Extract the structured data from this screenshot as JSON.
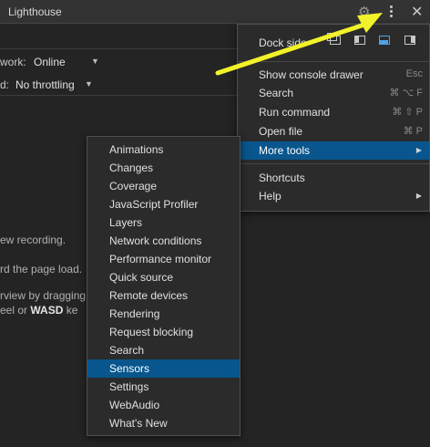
{
  "topbar": {
    "tab_title": "Lighthouse"
  },
  "toolbar": {
    "network_label": "work:",
    "network_value": "Online",
    "throttle_label": "d:",
    "throttle_value": "No throttling"
  },
  "background": {
    "line1": "ew recording.",
    "line2": "rd the page load.",
    "line3": "rview by dragging",
    "line4_pre": "eel or ",
    "line4_bold": "WASD",
    "line4_post": " ke"
  },
  "main_menu": {
    "dock_side_label": "Dock side",
    "dock_options": [
      "undock-into-separate-window",
      "dock-to-left",
      "dock-to-bottom",
      "dock-to-right"
    ],
    "dock_selected": "dock-to-bottom",
    "items": [
      {
        "label": "Show console drawer",
        "shortcut": "Esc"
      },
      {
        "label": "Search",
        "shortcut": "⌘ ⌥ F"
      },
      {
        "label": "Run command",
        "shortcut": "⌘ ⇧ P"
      },
      {
        "label": "Open file",
        "shortcut": "⌘ P"
      },
      {
        "label": "More tools",
        "shortcut": ""
      },
      {
        "label": "Shortcuts",
        "shortcut": ""
      },
      {
        "label": "Help",
        "shortcut": ""
      }
    ],
    "selected": "More tools"
  },
  "more_tools_menu": {
    "items": [
      "Animations",
      "Changes",
      "Coverage",
      "JavaScript Profiler",
      "Layers",
      "Network conditions",
      "Performance monitor",
      "Quick source",
      "Remote devices",
      "Rendering",
      "Request blocking",
      "Search",
      "Sensors",
      "Settings",
      "WebAudio",
      "What's New"
    ],
    "selected": "Sensors"
  },
  "colors": {
    "selection": "#08568d",
    "annotation_arrow": "#f2f22a",
    "active_dock": "#4da3e8"
  }
}
